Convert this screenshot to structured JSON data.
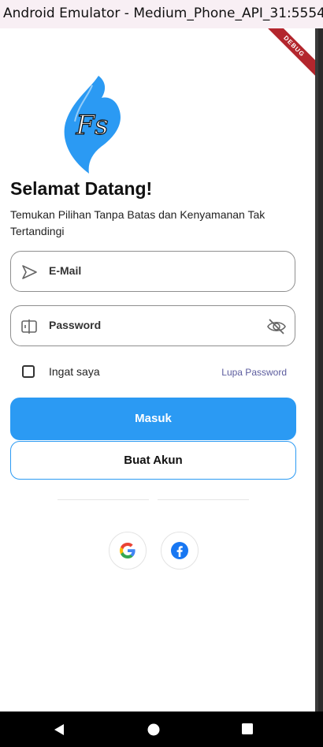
{
  "window": {
    "title": "Android Emulator - Medium_Phone_API_31:5554"
  },
  "debug_banner": "DEBUG",
  "logo": {
    "monogram": "Fs"
  },
  "login": {
    "title": "Selamat Datang!",
    "subtitle": "Temukan Pilihan Tanpa Batas dan Kenyamanan Tak Tertandingi",
    "email_label": "E-Mail",
    "password_label": "Password",
    "remember_label": "Ingat saya",
    "remember_checked": false,
    "forgot_label": "Lupa Password",
    "login_button": "Masuk",
    "register_button": "Buat Akun"
  },
  "social": {
    "items": [
      {
        "name": "google-icon"
      },
      {
        "name": "facebook-icon"
      }
    ]
  },
  "colors": {
    "primary": "#2b9af3",
    "link": "#5c5c9e",
    "ribbon": "#b3262d",
    "facebook": "#1877f2"
  },
  "navbar": {
    "icons": [
      "back-icon",
      "home-icon",
      "recents-icon"
    ]
  }
}
